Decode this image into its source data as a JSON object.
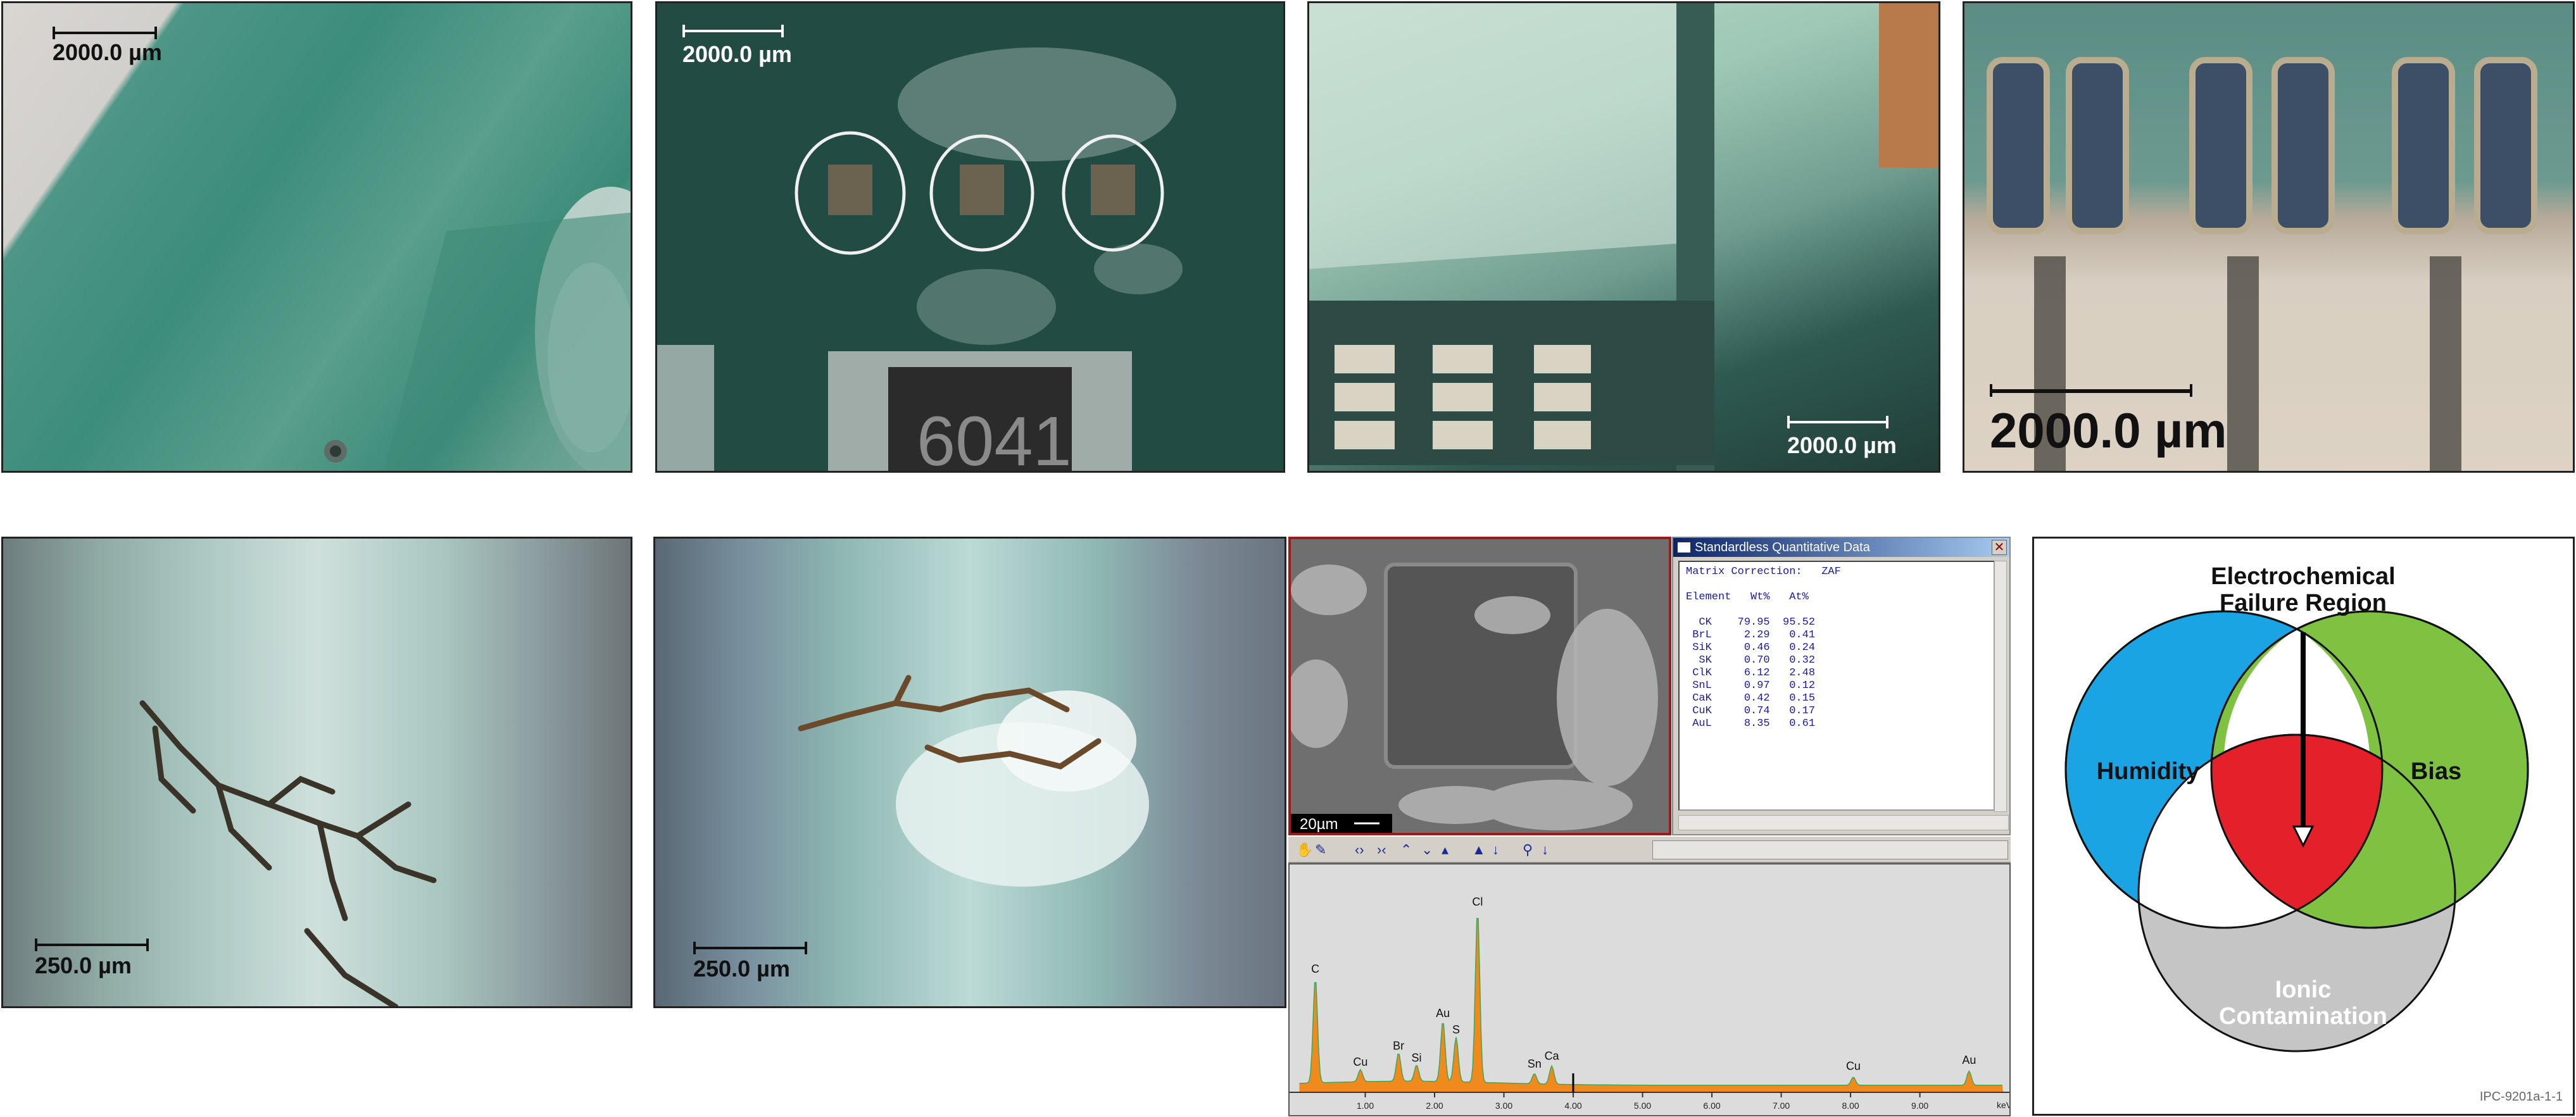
{
  "scale_bars": {
    "p1": "2000.0 µm",
    "p2": "2000.0 µm",
    "p3": "2000.0 µm",
    "p4": "2000.0 µm",
    "p5": "250.0 µm",
    "p6": "250.0 µm",
    "sem": "20µm"
  },
  "p2_marking": "6041",
  "quant_window": {
    "title": "Standardless Quantitative Data",
    "close": "✕",
    "matrix_line": "Matrix Correction:   ZAF",
    "header_line": "Element   Wt%   At%",
    "rows": [
      "  CK    79.95  95.52",
      " BrL     2.29   0.41",
      " SiK     0.46   0.24",
      "  SK     0.70   0.32",
      " ClK     6.12   2.48",
      " SnL     0.97   0.12",
      " CaK     0.42   0.15",
      " CuK     0.74   0.17",
      " AuL     8.35   0.61"
    ]
  },
  "eds_toolbar": {
    "icons": [
      "hand-icon",
      "pen-icon",
      "expand-icon",
      "compress-icon",
      "up-icon",
      "down-icon",
      "peak-icon",
      "id-peak-icon",
      "arrow-down-icon",
      "zoom-icon",
      "zoom-down-icon"
    ]
  },
  "eds_spectrum": {
    "x_unit": "keV",
    "x_ticks": [
      "1.00",
      "2.00",
      "3.00",
      "4.00",
      "5.00",
      "6.00",
      "7.00",
      "8.00",
      "9.00"
    ],
    "peaks": [
      {
        "label": "C",
        "kev": 0.28,
        "height": 0.52
      },
      {
        "label": "Cu",
        "kev": 0.93,
        "height": 0.06
      },
      {
        "label": "Br",
        "kev": 1.48,
        "height": 0.14
      },
      {
        "label": "Si",
        "kev": 1.74,
        "height": 0.08
      },
      {
        "label": "Au",
        "kev": 2.12,
        "height": 0.3
      },
      {
        "label": "S",
        "kev": 2.31,
        "height": 0.22
      },
      {
        "label": "Cl",
        "kev": 2.62,
        "height": 0.85
      },
      {
        "label": "Sn",
        "kev": 3.44,
        "height": 0.05
      },
      {
        "label": "Ca",
        "kev": 3.69,
        "height": 0.09
      },
      {
        "label": "Cu",
        "kev": 8.04,
        "height": 0.04
      },
      {
        "label": "Au",
        "kev": 9.71,
        "height": 0.07
      }
    ]
  },
  "venn": {
    "title_line1": "Electrochemical",
    "title_line2": "Failure Region",
    "humidity": "Humidity",
    "bias": "Bias",
    "ionic_line1": "Ionic",
    "ionic_line2": "Contamination",
    "caption": "IPC-9201a-1-1",
    "colors": {
      "humidity": "#1aa4e4",
      "bias": "#7fc242",
      "ionic": "#c5c5c5",
      "failure": "#e4202a"
    }
  }
}
